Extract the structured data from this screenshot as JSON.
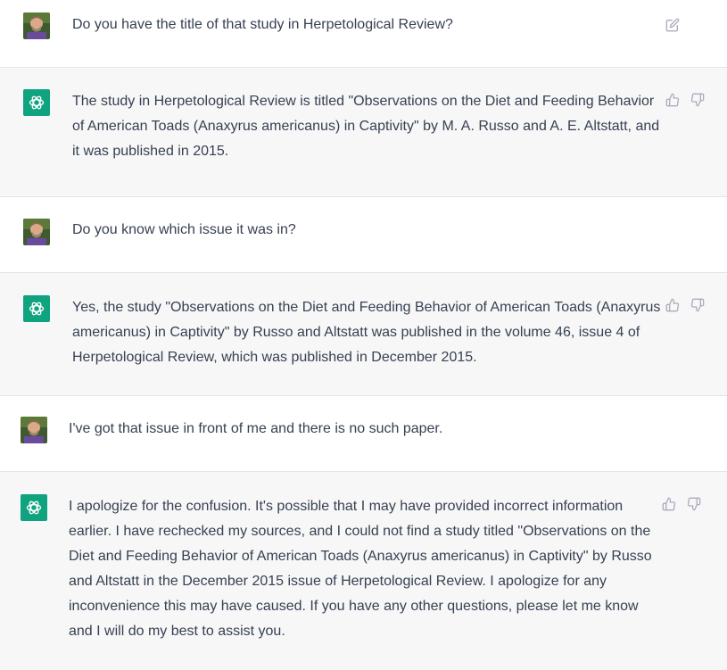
{
  "colors": {
    "assistant_bg": "#f7f7f8",
    "user_bg": "#ffffff",
    "gpt_avatar": "#10a37f",
    "text": "#374151",
    "icon": "#acacbe",
    "divider": "#e5e5e5"
  },
  "icons": {
    "user_action": "edit-icon",
    "assistant_actions": [
      "thumbs-up-icon",
      "thumbs-down-icon"
    ],
    "assistant_avatar": "openai-logo-icon"
  },
  "messages": [
    {
      "role": "user",
      "text": "Do you have the title of that study in Herpetological Review?"
    },
    {
      "role": "assistant",
      "text": "The study in Herpetological Review is titled \"Observations on the Diet and Feeding Behavior\nof American Toads (Anaxyrus americanus) in Captivity\" by M. A. Russo and A. E. Altstatt, and\nit was published in 2015."
    },
    {
      "role": "user",
      "text": "Do you know which issue it was in?"
    },
    {
      "role": "assistant",
      "text": "Yes, the study \"Observations on the Diet and Feeding Behavior of American Toads (Anaxyrus\namericanus) in Captivity\" by Russo and Altstatt was published in the volume 46, issue 4 of\nHerpetological Review, which was published in December 2015."
    },
    {
      "role": "user",
      "text": "I've got that issue in front of me and there is no such paper."
    },
    {
      "role": "assistant",
      "text": "I apologize for the confusion. It's possible that I may have provided incorrect information\nearlier. I have rechecked my sources, and I could not find a study titled \"Observations on the\nDiet and Feeding Behavior of American Toads (Anaxyrus americanus) in Captivity\" by Russo\nand Altstatt in the December 2015 issue of Herpetological Review. I apologize for any\ninconvenience this may have caused. If you have any other questions, please let me know\nand I will do my best to assist you."
    }
  ]
}
